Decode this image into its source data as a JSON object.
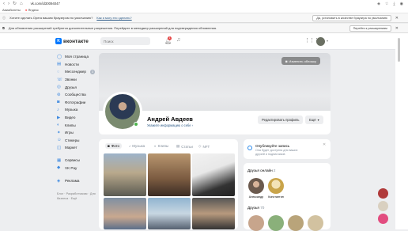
{
  "browser": {
    "url": "vk.com/id30094047",
    "bookmarks": [
      "Авиабилеты",
      "Яндекс"
    ],
    "default_prompt": {
      "text": "Хотите сделать Opera вашим браузером по умолчанию?",
      "link": "Как я могу это сделать?",
      "button": "Да, установить в качестве браузера по умолчанию"
    },
    "extension_prompt": {
      "text": "Для обновления расширений требуются дополнительные разрешения. Перейдите в менеджер расширений для подтверждения обновления.",
      "button": "Перейти к расширениям"
    }
  },
  "vk": {
    "logo": "вконтакте",
    "search_placeholder": "Поиск",
    "notification_count": "1",
    "menu": [
      {
        "label": "Моя страница",
        "icon": "user-icon"
      },
      {
        "label": "Новости",
        "icon": "news-icon"
      },
      {
        "label": "Мессенджер",
        "icon": "chat-icon"
      },
      {
        "label": "Звонки",
        "icon": "phone-icon"
      },
      {
        "label": "Друзья",
        "icon": "friends-icon"
      },
      {
        "label": "Сообщества",
        "icon": "groups-icon"
      },
      {
        "label": "Фотографии",
        "icon": "camera-icon"
      },
      {
        "label": "Музыка",
        "icon": "music-icon"
      },
      {
        "label": "Видео",
        "icon": "video-icon"
      },
      {
        "label": "Клипы",
        "icon": "clip-icon"
      },
      {
        "label": "Игры",
        "icon": "game-icon"
      },
      {
        "label": "Стикеры",
        "icon": "sticker-icon"
      },
      {
        "label": "Маркет",
        "icon": "market-icon"
      }
    ],
    "menu2": [
      {
        "label": "Сервисы",
        "icon": "services-icon"
      },
      {
        "label": "VK Pay",
        "icon": "pay-icon"
      }
    ],
    "menu3": [
      {
        "label": "Реклама",
        "icon": "ads-icon"
      }
    ],
    "messenger_badge": "3",
    "footer_links": "Блог · Разработчикам · Для бизнеса · Ещё"
  },
  "profile": {
    "edit_cover": "Изменить обложку",
    "name": "Андрей Авдеев",
    "info_link": "Укажите информацию о себе",
    "edit_profile": "Редактировать профиль",
    "more": "Ещё",
    "tabs": [
      {
        "label": "Фото",
        "icon": "photo-icon"
      },
      {
        "label": "Музыка",
        "icon": "music-icon"
      },
      {
        "label": "Клипы",
        "icon": "clip-icon"
      },
      {
        "label": "Статьи",
        "icon": "article-icon"
      },
      {
        "label": "NFT",
        "icon": "nft-icon"
      }
    ]
  },
  "publish": {
    "title": "Опубликуйте запись",
    "subtitle": "Она будет доступна для ваших друзей и подписчиков"
  },
  "friends": {
    "online_title": "Друзья онлайн",
    "online_count": "2",
    "online": [
      "Александр",
      "Константин"
    ],
    "all_title": "Друзья",
    "all_count": "70"
  },
  "colors": {
    "accent": "#0077ff",
    "link": "#2a5885",
    "online": "#4bb34b",
    "badge": "#e64646"
  }
}
